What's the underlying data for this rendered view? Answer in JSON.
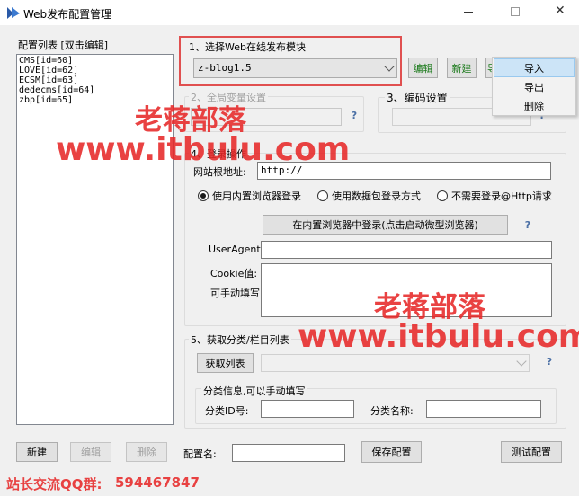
{
  "window": {
    "title": "Web发布配置管理"
  },
  "left_panel": {
    "header": "配置列表 [双击编辑]",
    "items": [
      "CMS[id=60]",
      "LOVE[id=62]",
      "ECSM[id=63]",
      "dedecms[id=64]",
      "zbp[id=65]"
    ]
  },
  "module_section": {
    "legend": "1、选择Web在线发布模块",
    "selected": "z-blog1.5",
    "edit_label": "编辑",
    "new_label": "新建",
    "more_label": "导"
  },
  "context_menu": {
    "items": [
      "导入",
      "导出",
      "删除"
    ]
  },
  "global_vars": {
    "legend": "2、全局变量设置"
  },
  "encoding": {
    "legend": "3、编码设置"
  },
  "login": {
    "legend": "4、登录操作",
    "site_root_label": "网站根地址:",
    "site_root_value": "http://",
    "radio_builtin": "使用内置浏览器登录",
    "radio_packet": "使用数据包登录方式",
    "radio_none": "不需要登录@Http请求",
    "browser_login_button": "在内置浏览器中登录(点击启动微型浏览器)",
    "useragent_label": "UserAgent",
    "cookie_label": "Cookie值:",
    "manual_label": "可手动填写"
  },
  "category": {
    "legend": "5、获取分类/栏目列表",
    "fetch_button": "获取列表",
    "info_legend": "分类信息,可以手动填写",
    "id_label": "分类ID号:",
    "name_label": "分类名称:"
  },
  "bottom": {
    "new_label": "新建",
    "edit_label": "编辑",
    "delete_label": "删除",
    "config_name_label": "配置名:",
    "save_label": "保存配置",
    "test_label": "测试配置"
  },
  "watermarks": {
    "brand": "老蒋部落",
    "url": "www.itbulu.com",
    "qq_prefix": "站长交流QQ群:",
    "qq_number": "594467847"
  },
  "colors": {
    "accent_red": "#e02828",
    "highlight_box": "#e05050",
    "menu_selected": "#cce4f7"
  }
}
